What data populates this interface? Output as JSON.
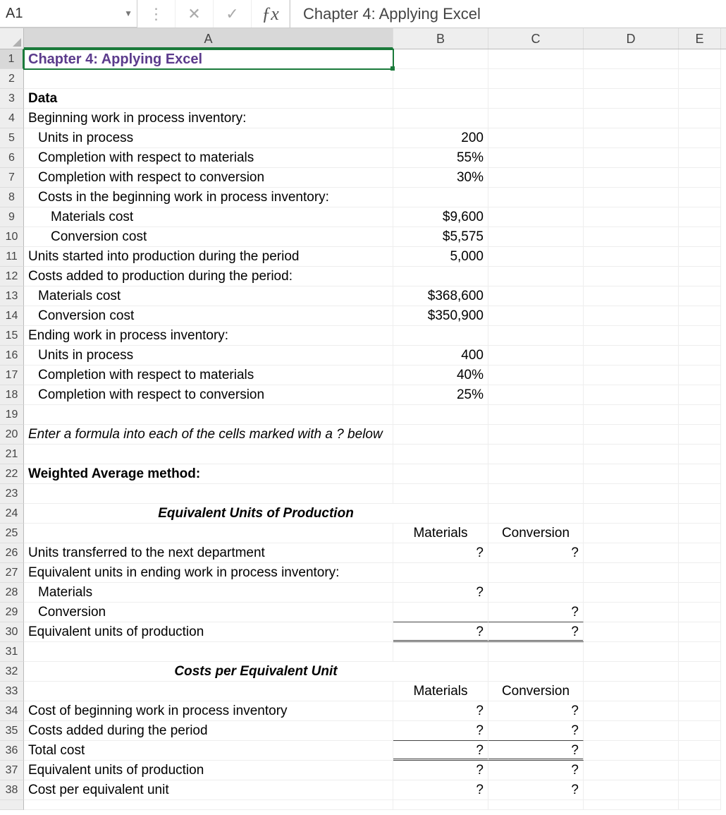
{
  "nameBox": "A1",
  "formulaBar": "Chapter 4: Applying Excel",
  "columns": [
    "A",
    "B",
    "C",
    "D",
    "E"
  ],
  "sectionHeaders": {
    "equivUnits": "Equivalent Units of Production",
    "costsPer": "Costs per Equivalent Unit"
  },
  "colHeaders": {
    "materials": "Materials",
    "conversion": "Conversion"
  },
  "rows": {
    "1": {
      "a": "Chapter 4: Applying Excel"
    },
    "2": {},
    "3": {
      "a": "Data"
    },
    "4": {
      "a": "Beginning work in process inventory:"
    },
    "5": {
      "a": "Units in process",
      "b": "200"
    },
    "6": {
      "a": "Completion with respect to materials",
      "b": "55%"
    },
    "7": {
      "a": "Completion with respect to conversion",
      "b": "30%"
    },
    "8": {
      "a": "Costs in the beginning work in process inventory:"
    },
    "9": {
      "a": "Materials cost",
      "b": "$9,600"
    },
    "10": {
      "a": "Conversion cost",
      "b": "$5,575"
    },
    "11": {
      "a": "Units started into production during the period",
      "b": "5,000"
    },
    "12": {
      "a": "Costs added to production during the period:"
    },
    "13": {
      "a": "Materials cost",
      "b": "$368,600"
    },
    "14": {
      "a": "Conversion cost",
      "b": "$350,900"
    },
    "15": {
      "a": "Ending work in process inventory:"
    },
    "16": {
      "a": "Units in process",
      "b": "400"
    },
    "17": {
      "a": "Completion with respect to materials",
      "b": "40%"
    },
    "18": {
      "a": "Completion with respect to conversion",
      "b": "25%"
    },
    "19": {},
    "20": {
      "a": "Enter a formula into each of the cells marked with a ? below"
    },
    "21": {},
    "22": {
      "a": "Weighted Average method:"
    },
    "23": {},
    "24": {},
    "25": {},
    "26": {
      "a": "Units transferred to the next department",
      "b": "?",
      "c": "?"
    },
    "27": {
      "a": "Equivalent units in ending work in process inventory:"
    },
    "28": {
      "a": "Materials",
      "b": "?"
    },
    "29": {
      "a": "Conversion",
      "c": "?"
    },
    "30": {
      "a": "Equivalent units of production",
      "b": "?",
      "c": "?"
    },
    "31": {},
    "32": {},
    "33": {},
    "34": {
      "a": "Cost of beginning work in process inventory",
      "b": "?",
      "c": "?"
    },
    "35": {
      "a": "Costs added during the period",
      "b": "?",
      "c": "?"
    },
    "36": {
      "a": "Total cost",
      "b": "?",
      "c": "?"
    },
    "37": {
      "a": "Equivalent units of production",
      "b": "?",
      "c": "?"
    },
    "38": {
      "a": "Cost per equivalent unit",
      "b": "?",
      "c": "?"
    }
  }
}
